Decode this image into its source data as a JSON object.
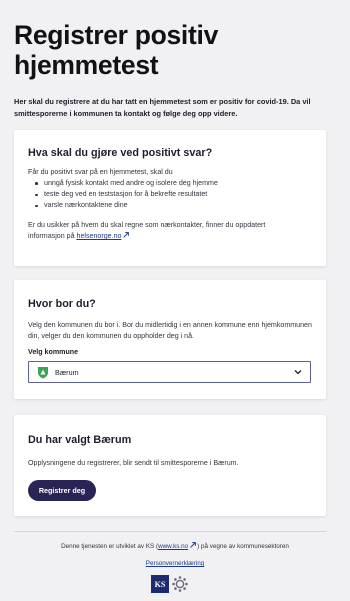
{
  "header": {
    "title": "Registrer positiv hjemmetest",
    "intro": "Her skal du registrere at du har tatt en hjemmetest som er positiv for covid-19. Da vil smittesporerne i kommunen ta kontakt og følge deg opp videre."
  },
  "info_card": {
    "heading": "Hva skal du gjøre ved positivt svar?",
    "lead": "Får du positivt svar på en hjemmetest, skal du",
    "bullets": [
      "unngå fysisk kontakt med andre og isolere deg hjemme",
      "teste deg ved en teststasjon for å bekrefte resultatet",
      "varsle nærkontaktene dine"
    ],
    "foot_text_1": "Er du usikker på hvem du skal regne som nærkontakter, finner du oppdatert",
    "foot_text_2": "informasjon på ",
    "foot_link": "helsenorge.no"
  },
  "location_card": {
    "heading": "Hvor bor du?",
    "text": "Velg den kommunen du bor i. Bor du midlertidig i en annen kommune enn hjemkommunen din, velger du den kommunen du oppholder deg i nå.",
    "field_label": "Velg kommune",
    "selected_value": "Bærum",
    "icons": {
      "coat_of_arms": "shield-icon",
      "dropdown": "chevron-down-icon"
    }
  },
  "confirm_card": {
    "heading": "Du har valgt Bærum",
    "text": "Opplysningene du registrerer, blir sendt til smittesporerne i Bærum.",
    "button_label": "Registrer deg"
  },
  "footer": {
    "credit_before": "Denne tjenesten er utviklet av KS (",
    "credit_link": "www.ks.no",
    "credit_after": ") på vegne av kommunesektoren",
    "privacy_link": "Personvernerklæring",
    "logo_text": "KS"
  },
  "colors": {
    "background": "#f1f1f3",
    "primary_button": "#282456",
    "link": "#1a3a8f",
    "select_border": "#5d5f9a"
  }
}
